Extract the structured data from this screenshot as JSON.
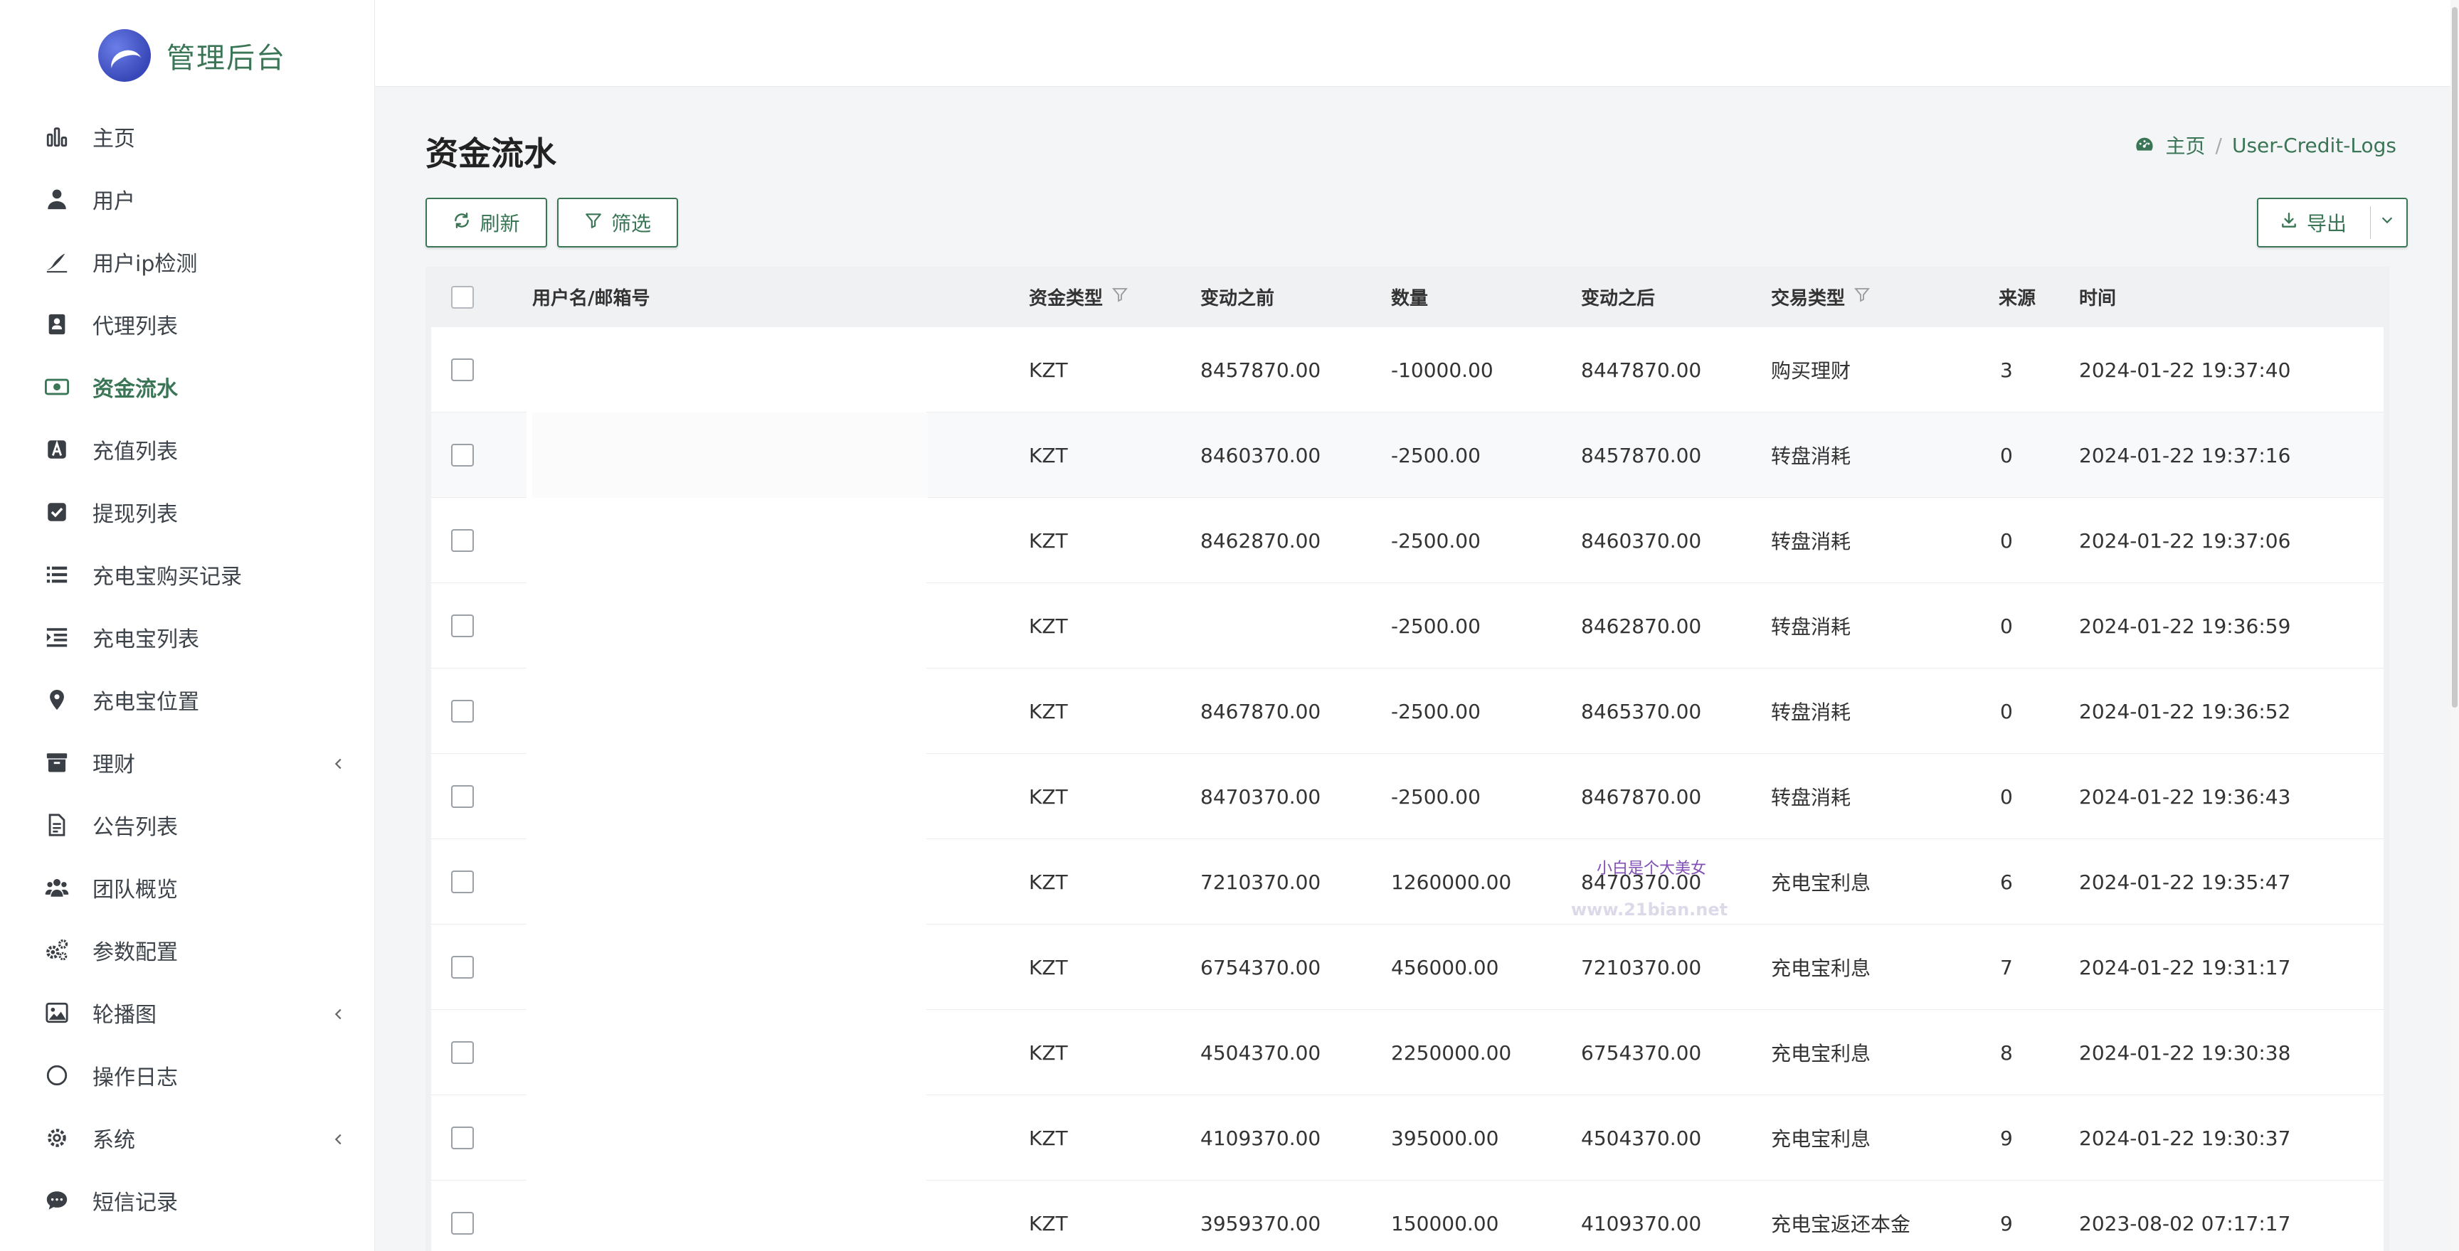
{
  "brand": {
    "title": "管理后台"
  },
  "sidebar": {
    "items": [
      {
        "label": "主页",
        "icon": "bar-chart-icon"
      },
      {
        "label": "用户",
        "icon": "user-icon"
      },
      {
        "label": "用户ip检测",
        "icon": "signature-icon"
      },
      {
        "label": "代理列表",
        "icon": "address-book-icon"
      },
      {
        "label": "资金流水",
        "icon": "money-bill-icon",
        "active": true
      },
      {
        "label": "充值列表",
        "icon": "font-box-icon"
      },
      {
        "label": "提现列表",
        "icon": "check-square-icon"
      },
      {
        "label": "充电宝购买记录",
        "icon": "list-icon"
      },
      {
        "label": "充电宝列表",
        "icon": "indent-icon"
      },
      {
        "label": "充电宝位置",
        "icon": "map-marker-icon"
      },
      {
        "label": "理财",
        "icon": "archive-icon",
        "expandable": true
      },
      {
        "label": "公告列表",
        "icon": "file-text-icon"
      },
      {
        "label": "团队概览",
        "icon": "users-icon"
      },
      {
        "label": "参数配置",
        "icon": "cogs-icon"
      },
      {
        "label": "轮播图",
        "icon": "image-icon",
        "expandable": true
      },
      {
        "label": "操作日志",
        "icon": "circle-icon"
      },
      {
        "label": "系统",
        "icon": "gear-icon",
        "expandable": true
      },
      {
        "label": "短信记录",
        "icon": "comment-icon"
      }
    ]
  },
  "page": {
    "title": "资金流水"
  },
  "breadcrumb": {
    "home": "主页",
    "current": "User-Credit-Logs"
  },
  "toolbar": {
    "refresh": "刷新",
    "filter": "筛选",
    "export": "导出"
  },
  "table": {
    "columns": {
      "user": "用户名/邮箱号",
      "fund_type": "资金类型",
      "before": "变动之前",
      "amount": "数量",
      "after": "变动之后",
      "trade_type": "交易类型",
      "source": "来源",
      "time": "时间"
    },
    "rows": [
      {
        "fund_type": "KZT",
        "before": "8457870.00",
        "amount": "-10000.00",
        "after": "8447870.00",
        "trade_type": "购买理财",
        "source": "3",
        "time": "2024-01-22 19:37:40"
      },
      {
        "fund_type": "KZT",
        "before": "8460370.00",
        "amount": "-2500.00",
        "after": "8457870.00",
        "trade_type": "转盘消耗",
        "source": "0",
        "time": "2024-01-22 19:37:16"
      },
      {
        "fund_type": "KZT",
        "before": "8462870.00",
        "amount": "-2500.00",
        "after": "8460370.00",
        "trade_type": "转盘消耗",
        "source": "0",
        "time": "2024-01-22 19:37:06"
      },
      {
        "fund_type": "KZT",
        "before": "",
        "amount": "-2500.00",
        "after": "8462870.00",
        "trade_type": "转盘消耗",
        "source": "0",
        "time": "2024-01-22 19:36:59"
      },
      {
        "fund_type": "KZT",
        "before": "8467870.00",
        "amount": "-2500.00",
        "after": "8465370.00",
        "trade_type": "转盘消耗",
        "source": "0",
        "time": "2024-01-22 19:36:52"
      },
      {
        "fund_type": "KZT",
        "before": "8470370.00",
        "amount": "-2500.00",
        "after": "8467870.00",
        "trade_type": "转盘消耗",
        "source": "0",
        "time": "2024-01-22 19:36:43"
      },
      {
        "fund_type": "KZT",
        "before": "7210370.00",
        "amount": "1260000.00",
        "after": "8470370.00",
        "trade_type": "充电宝利息",
        "source": "6",
        "time": "2024-01-22 19:35:47"
      },
      {
        "fund_type": "KZT",
        "before": "6754370.00",
        "amount": "456000.00",
        "after": "7210370.00",
        "trade_type": "充电宝利息",
        "source": "7",
        "time": "2024-01-22 19:31:17"
      },
      {
        "fund_type": "KZT",
        "before": "4504370.00",
        "amount": "2250000.00",
        "after": "6754370.00",
        "trade_type": "充电宝利息",
        "source": "8",
        "time": "2024-01-22 19:30:38"
      },
      {
        "fund_type": "KZT",
        "before": "4109370.00",
        "amount": "395000.00",
        "after": "4504370.00",
        "trade_type": "充电宝利息",
        "source": "9",
        "time": "2024-01-22 19:30:37"
      },
      {
        "fund_type": "KZT",
        "before": "3959370.00",
        "amount": "150000.00",
        "after": "4109370.00",
        "trade_type": "充电宝返还本金",
        "source": "9",
        "time": "2023-08-02 07:17:17"
      }
    ]
  },
  "watermark": {
    "line1": "小白是个大美女",
    "line2": "www.21bian.net"
  },
  "colors": {
    "accent": "#3a7556",
    "background": "#f4f5f7"
  }
}
